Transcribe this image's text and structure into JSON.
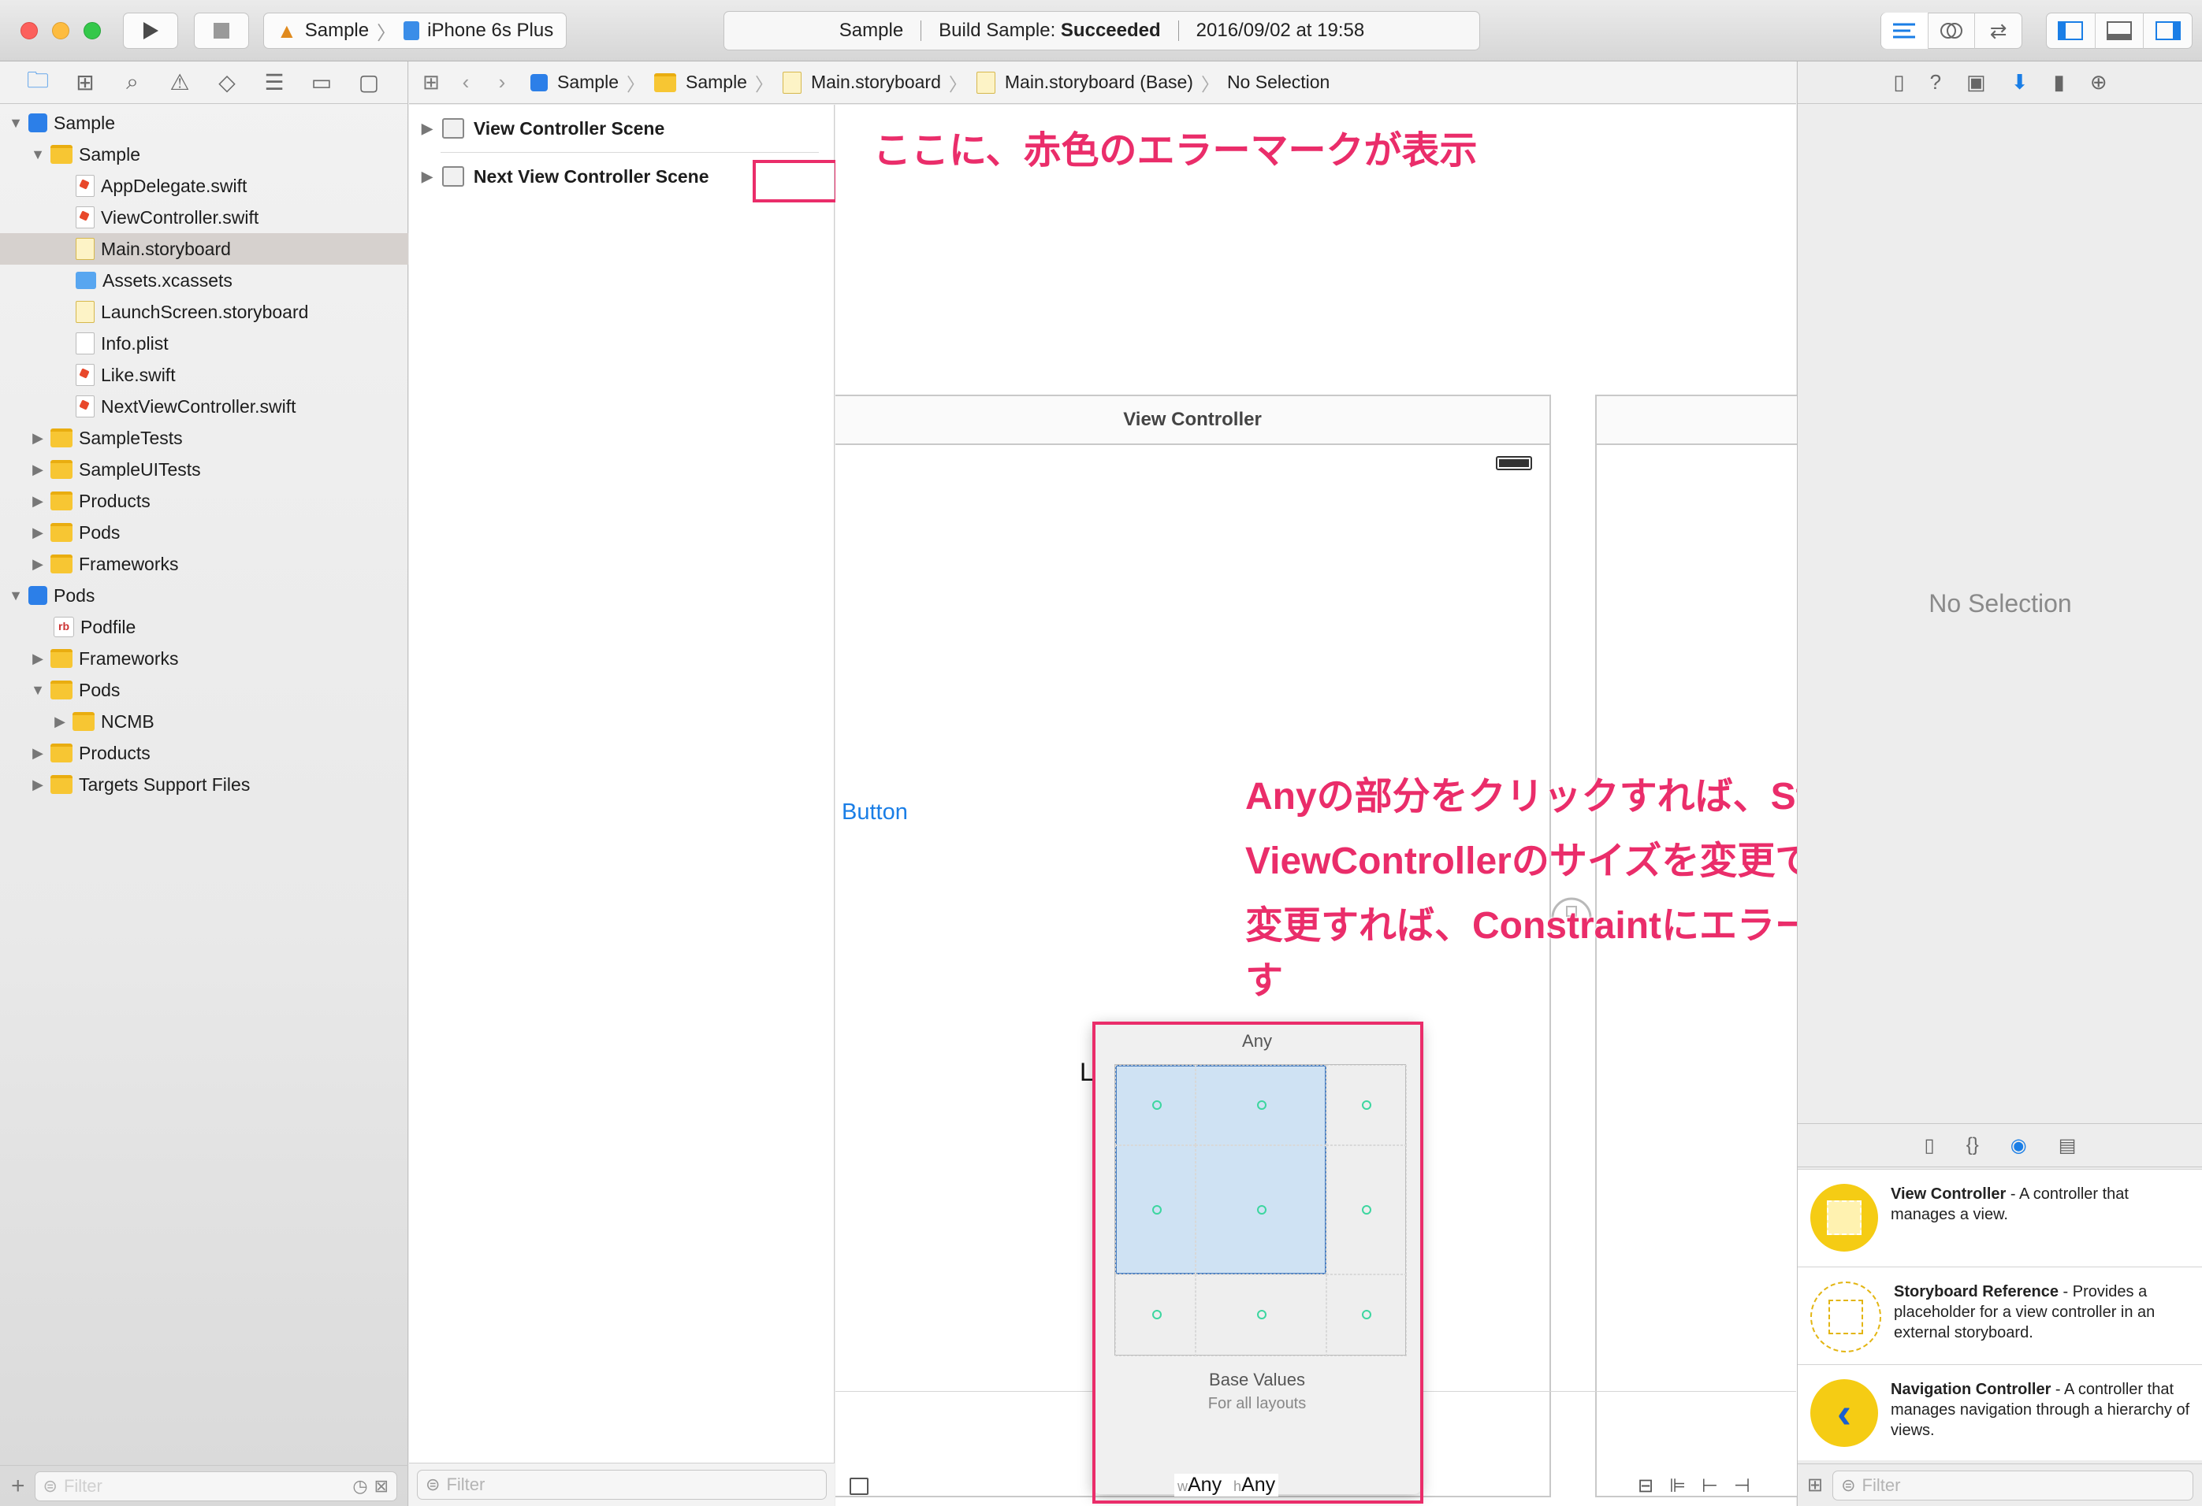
{
  "toolbar": {
    "scheme": "Sample",
    "device": "iPhone 6s Plus",
    "status_project": "Sample",
    "status_build_prefix": "Build Sample: ",
    "status_build_result": "Succeeded",
    "status_time": "2016/09/02 at 19:58"
  },
  "navigator": {
    "items": [
      {
        "label": "Sample"
      },
      {
        "label": "Sample"
      },
      {
        "label": "AppDelegate.swift"
      },
      {
        "label": "ViewController.swift"
      },
      {
        "label": "Main.storyboard"
      },
      {
        "label": "Assets.xcassets"
      },
      {
        "label": "LaunchScreen.storyboard"
      },
      {
        "label": "Info.plist"
      },
      {
        "label": "Like.swift"
      },
      {
        "label": "NextViewController.swift"
      },
      {
        "label": "SampleTests"
      },
      {
        "label": "SampleUITests"
      },
      {
        "label": "Products"
      },
      {
        "label": "Pods"
      },
      {
        "label": "Frameworks"
      },
      {
        "label": "Pods"
      },
      {
        "label": "Podfile"
      },
      {
        "label": "Frameworks"
      },
      {
        "label": "Pods"
      },
      {
        "label": "NCMB"
      },
      {
        "label": "Products"
      },
      {
        "label": "Targets Support Files"
      }
    ],
    "filter_placeholder": "Filter"
  },
  "jumpbar": {
    "crumbs": [
      "Sample",
      "Sample",
      "Main.storyboard",
      "Main.storyboard (Base)",
      "No Selection"
    ]
  },
  "outline": {
    "scenes": [
      "View Controller Scene",
      "Next View Controller Scene"
    ],
    "filter_placeholder": "Filter"
  },
  "canvas": {
    "vc_title": "View Controller",
    "button_label": "Button",
    "label_text": "Label",
    "annotation_top": "ここに、赤色のエラーマークが表示",
    "annotation_lines": [
      "Anyの部分をクリックすれば、Storyboardの",
      "ViewControllerのサイズを変更できますので、",
      "変更すれば、Constraintにエラーが出ると思いま",
      "す"
    ],
    "size_class": {
      "title": "Any",
      "base_values": "Base Values",
      "for_all_layouts": "For all layouts",
      "w_prefix": "w",
      "w_value": "Any",
      "h_prefix": "h",
      "h_value": "Any"
    }
  },
  "inspector": {
    "no_selection": "No Selection",
    "library": [
      {
        "name": "View Controller",
        "desc": " - A controller that manages a view."
      },
      {
        "name": "Storyboard Reference",
        "desc": " - Provides a placeholder for a view controller in an external storyboard."
      },
      {
        "name": "Navigation Controller",
        "desc": " - A controller that manages navigation through a hierarchy of views."
      }
    ],
    "filter_placeholder": "Filter"
  },
  "colors": {
    "annotation": "#ea2d6a",
    "accent": "#1a7ee6",
    "folder": "#f7c633"
  }
}
